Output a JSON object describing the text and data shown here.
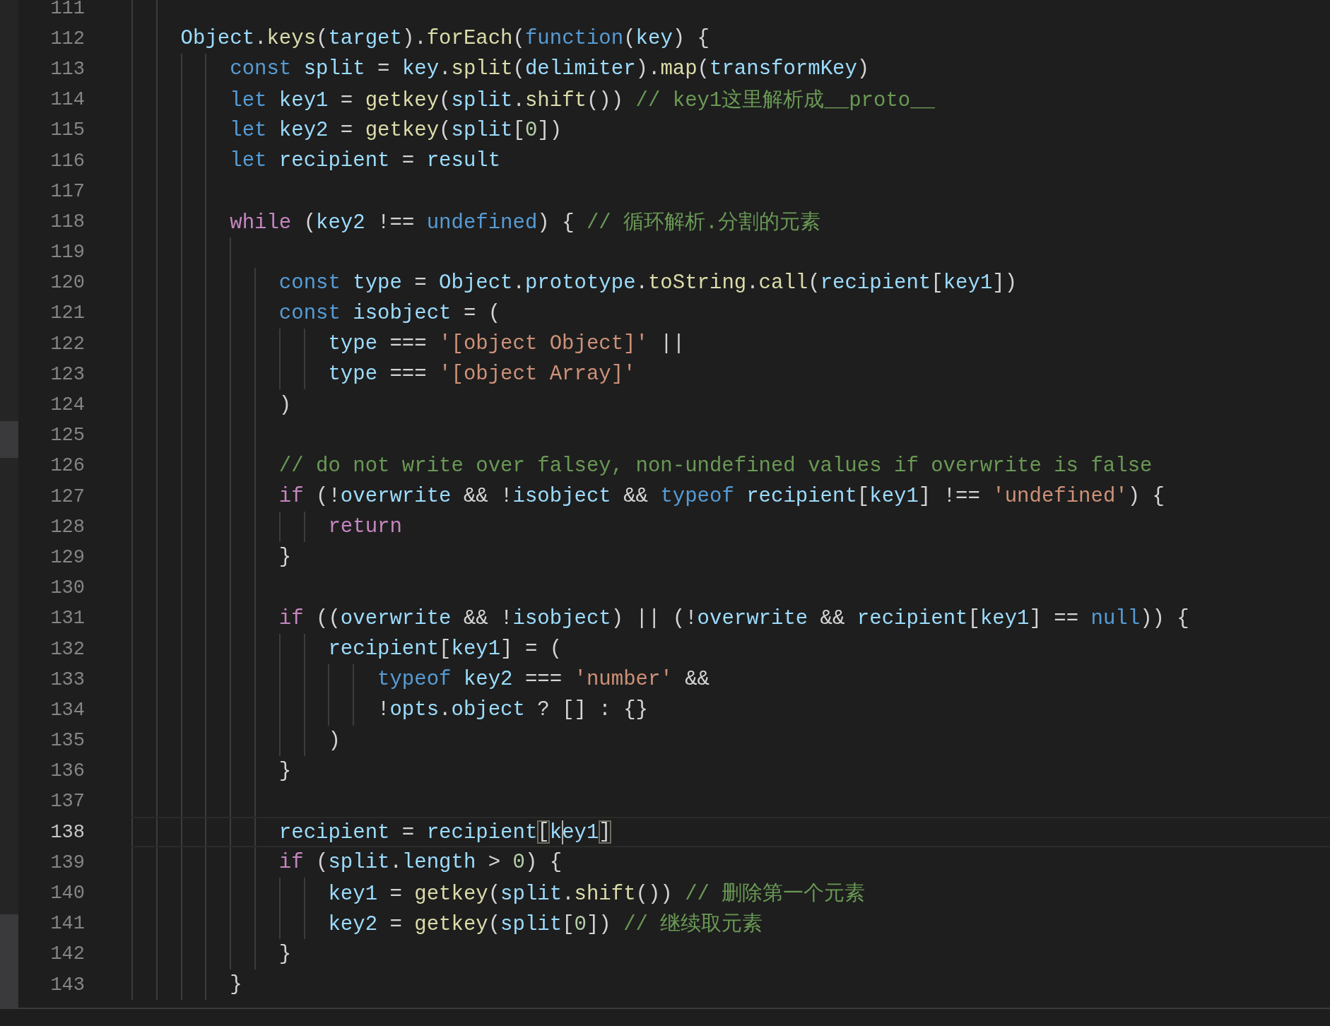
{
  "editor": {
    "lines": [
      {
        "number": "111",
        "current": false
      },
      {
        "number": "112",
        "current": false,
        "tokens": [
          {
            "kind": "variable",
            "text": "    Object"
          },
          {
            "kind": "plain",
            "text": "."
          },
          {
            "kind": "function",
            "text": "keys"
          },
          {
            "kind": "plain",
            "text": "("
          },
          {
            "kind": "variable",
            "text": "target"
          },
          {
            "kind": "plain",
            "text": ")."
          },
          {
            "kind": "function",
            "text": "forEach"
          },
          {
            "kind": "plain",
            "text": "("
          },
          {
            "kind": "keyword",
            "text": "function"
          },
          {
            "kind": "plain",
            "text": "("
          },
          {
            "kind": "variable",
            "text": "key"
          },
          {
            "kind": "plain",
            "text": ") {"
          }
        ]
      },
      {
        "number": "113",
        "current": false,
        "tokens": [
          {
            "kind": "keyword",
            "text": "        const"
          },
          {
            "kind": "variable",
            "text": " split"
          },
          {
            "kind": "plain",
            "text": " = "
          },
          {
            "kind": "variable",
            "text": "key"
          },
          {
            "kind": "plain",
            "text": "."
          },
          {
            "kind": "function",
            "text": "split"
          },
          {
            "kind": "plain",
            "text": "("
          },
          {
            "kind": "variable",
            "text": "delimiter"
          },
          {
            "kind": "plain",
            "text": ")."
          },
          {
            "kind": "function",
            "text": "map"
          },
          {
            "kind": "plain",
            "text": "("
          },
          {
            "kind": "variable",
            "text": "transformKey"
          },
          {
            "kind": "plain",
            "text": ")"
          }
        ]
      },
      {
        "number": "114",
        "current": false,
        "tokens": [
          {
            "kind": "keyword",
            "text": "        let"
          },
          {
            "kind": "variable",
            "text": " key1"
          },
          {
            "kind": "plain",
            "text": " = "
          },
          {
            "kind": "function",
            "text": "getkey"
          },
          {
            "kind": "plain",
            "text": "("
          },
          {
            "kind": "variable",
            "text": "split"
          },
          {
            "kind": "plain",
            "text": "."
          },
          {
            "kind": "function",
            "text": "shift"
          },
          {
            "kind": "plain",
            "text": "()) "
          },
          {
            "kind": "comment",
            "text": "// key1这里解析成__proto__"
          }
        ]
      },
      {
        "number": "115",
        "current": false,
        "tokens": [
          {
            "kind": "keyword",
            "text": "        let"
          },
          {
            "kind": "variable",
            "text": " key2"
          },
          {
            "kind": "plain",
            "text": " = "
          },
          {
            "kind": "function",
            "text": "getkey"
          },
          {
            "kind": "plain",
            "text": "("
          },
          {
            "kind": "variable",
            "text": "split"
          },
          {
            "kind": "plain",
            "text": "["
          },
          {
            "kind": "number",
            "text": "0"
          },
          {
            "kind": "plain",
            "text": "])"
          }
        ]
      },
      {
        "number": "116",
        "current": false,
        "tokens": [
          {
            "kind": "keyword",
            "text": "        let"
          },
          {
            "kind": "variable",
            "text": " recipient"
          },
          {
            "kind": "plain",
            "text": " = "
          },
          {
            "kind": "variable",
            "text": "result"
          }
        ]
      },
      {
        "number": "117",
        "current": false
      },
      {
        "number": "118",
        "current": false,
        "tokens": [
          {
            "kind": "control",
            "text": "        while"
          },
          {
            "kind": "plain",
            "text": " ("
          },
          {
            "kind": "variable",
            "text": "key2"
          },
          {
            "kind": "plain",
            "text": " !== "
          },
          {
            "kind": "keyword",
            "text": "undefined"
          },
          {
            "kind": "plain",
            "text": ") { "
          },
          {
            "kind": "comment",
            "text": "// 循环解析.分割的元素"
          }
        ]
      },
      {
        "number": "119",
        "current": false
      },
      {
        "number": "120",
        "current": false,
        "tokens": [
          {
            "kind": "keyword",
            "text": "            const"
          },
          {
            "kind": "variable",
            "text": " type"
          },
          {
            "kind": "plain",
            "text": " = "
          },
          {
            "kind": "variable",
            "text": "Object"
          },
          {
            "kind": "plain",
            "text": "."
          },
          {
            "kind": "variable",
            "text": "prototype"
          },
          {
            "kind": "plain",
            "text": "."
          },
          {
            "kind": "function",
            "text": "toString"
          },
          {
            "kind": "plain",
            "text": "."
          },
          {
            "kind": "function",
            "text": "call"
          },
          {
            "kind": "plain",
            "text": "("
          },
          {
            "kind": "variable",
            "text": "recipient"
          },
          {
            "kind": "plain",
            "text": "["
          },
          {
            "kind": "variable",
            "text": "key1"
          },
          {
            "kind": "plain",
            "text": "])"
          }
        ]
      },
      {
        "number": "121",
        "current": false,
        "tokens": [
          {
            "kind": "keyword",
            "text": "            const"
          },
          {
            "kind": "variable",
            "text": " isobject"
          },
          {
            "kind": "plain",
            "text": " = ("
          }
        ]
      },
      {
        "number": "122",
        "current": false,
        "tokens": [
          {
            "kind": "variable",
            "text": "                type"
          },
          {
            "kind": "plain",
            "text": " === "
          },
          {
            "kind": "string",
            "text": "'[object Object]'"
          },
          {
            "kind": "plain",
            "text": " ||"
          }
        ]
      },
      {
        "number": "123",
        "current": false,
        "tokens": [
          {
            "kind": "variable",
            "text": "                type"
          },
          {
            "kind": "plain",
            "text": " === "
          },
          {
            "kind": "string",
            "text": "'[object Array]'"
          }
        ]
      },
      {
        "number": "124",
        "current": false,
        "tokens": [
          {
            "kind": "plain",
            "text": "            )"
          }
        ]
      },
      {
        "number": "125",
        "current": false
      },
      {
        "number": "126",
        "current": false,
        "tokens": [
          {
            "kind": "comment",
            "text": "            // do not write over falsey, non-undefined values if overwrite is false"
          }
        ]
      },
      {
        "number": "127",
        "current": false,
        "tokens": [
          {
            "kind": "control",
            "text": "            if"
          },
          {
            "kind": "plain",
            "text": " (!"
          },
          {
            "kind": "variable",
            "text": "overwrite"
          },
          {
            "kind": "plain",
            "text": " && !"
          },
          {
            "kind": "variable",
            "text": "isobject"
          },
          {
            "kind": "plain",
            "text": " && "
          },
          {
            "kind": "keyword",
            "text": "typeof"
          },
          {
            "kind": "variable",
            "text": " recipient"
          },
          {
            "kind": "plain",
            "text": "["
          },
          {
            "kind": "variable",
            "text": "key1"
          },
          {
            "kind": "plain",
            "text": "] !== "
          },
          {
            "kind": "string",
            "text": "'undefined'"
          },
          {
            "kind": "plain",
            "text": ") {"
          }
        ]
      },
      {
        "number": "128",
        "current": false,
        "tokens": [
          {
            "kind": "control",
            "text": "                return"
          }
        ]
      },
      {
        "number": "129",
        "current": false,
        "tokens": [
          {
            "kind": "plain",
            "text": "            }"
          }
        ]
      },
      {
        "number": "130",
        "current": false
      },
      {
        "number": "131",
        "current": false,
        "tokens": [
          {
            "kind": "control",
            "text": "            if"
          },
          {
            "kind": "plain",
            "text": " (("
          },
          {
            "kind": "variable",
            "text": "overwrite"
          },
          {
            "kind": "plain",
            "text": " && !"
          },
          {
            "kind": "variable",
            "text": "isobject"
          },
          {
            "kind": "plain",
            "text": ") || (!"
          },
          {
            "kind": "variable",
            "text": "overwrite"
          },
          {
            "kind": "plain",
            "text": " && "
          },
          {
            "kind": "variable",
            "text": "recipient"
          },
          {
            "kind": "plain",
            "text": "["
          },
          {
            "kind": "variable",
            "text": "key1"
          },
          {
            "kind": "plain",
            "text": "] == "
          },
          {
            "kind": "keyword",
            "text": "null"
          },
          {
            "kind": "plain",
            "text": ")) {"
          }
        ]
      },
      {
        "number": "132",
        "current": false,
        "tokens": [
          {
            "kind": "variable",
            "text": "                recipient"
          },
          {
            "kind": "plain",
            "text": "["
          },
          {
            "kind": "variable",
            "text": "key1"
          },
          {
            "kind": "plain",
            "text": "] = ("
          }
        ]
      },
      {
        "number": "133",
        "current": false,
        "tokens": [
          {
            "kind": "keyword",
            "text": "                    typeof"
          },
          {
            "kind": "variable",
            "text": " key2"
          },
          {
            "kind": "plain",
            "text": " === "
          },
          {
            "kind": "string",
            "text": "'number'"
          },
          {
            "kind": "plain",
            "text": " &&"
          }
        ]
      },
      {
        "number": "134",
        "current": false,
        "tokens": [
          {
            "kind": "plain",
            "text": "                    !"
          },
          {
            "kind": "variable",
            "text": "opts"
          },
          {
            "kind": "plain",
            "text": "."
          },
          {
            "kind": "variable",
            "text": "object"
          },
          {
            "kind": "plain",
            "text": " ? [] : {}"
          }
        ]
      },
      {
        "number": "135",
        "current": false,
        "tokens": [
          {
            "kind": "plain",
            "text": "                )"
          }
        ]
      },
      {
        "number": "136",
        "current": false,
        "tokens": [
          {
            "kind": "plain",
            "text": "            }"
          }
        ]
      },
      {
        "number": "137",
        "current": false
      },
      {
        "number": "138",
        "current": true,
        "tokens": [
          {
            "kind": "variable",
            "text": "            recipient"
          },
          {
            "kind": "plain",
            "text": " = "
          },
          {
            "kind": "variable",
            "text": "recipient"
          },
          {
            "kind": "matched_bracket",
            "text": "["
          },
          {
            "kind": "variable",
            "text": "k",
            "caret": true
          },
          {
            "kind": "variable",
            "text": "ey1"
          },
          {
            "kind": "matched_bracket",
            "text": "]"
          }
        ]
      },
      {
        "number": "139",
        "current": false,
        "tokens": [
          {
            "kind": "control",
            "text": "            if"
          },
          {
            "kind": "plain",
            "text": " ("
          },
          {
            "kind": "variable",
            "text": "split"
          },
          {
            "kind": "plain",
            "text": "."
          },
          {
            "kind": "variable",
            "text": "length"
          },
          {
            "kind": "plain",
            "text": " > "
          },
          {
            "kind": "number",
            "text": "0"
          },
          {
            "kind": "plain",
            "text": ") {"
          }
        ]
      },
      {
        "number": "140",
        "current": false,
        "tokens": [
          {
            "kind": "variable",
            "text": "                key1"
          },
          {
            "kind": "plain",
            "text": " = "
          },
          {
            "kind": "function",
            "text": "getkey"
          },
          {
            "kind": "plain",
            "text": "("
          },
          {
            "kind": "variable",
            "text": "split"
          },
          {
            "kind": "plain",
            "text": "."
          },
          {
            "kind": "function",
            "text": "shift"
          },
          {
            "kind": "plain",
            "text": "()) "
          },
          {
            "kind": "comment",
            "text": "// 删除第一个元素"
          }
        ]
      },
      {
        "number": "141",
        "current": false,
        "tokens": [
          {
            "kind": "variable",
            "text": "                key2"
          },
          {
            "kind": "plain",
            "text": " = "
          },
          {
            "kind": "function",
            "text": "getkey"
          },
          {
            "kind": "plain",
            "text": "("
          },
          {
            "kind": "variable",
            "text": "split"
          },
          {
            "kind": "plain",
            "text": "["
          },
          {
            "kind": "number",
            "text": "0"
          },
          {
            "kind": "plain",
            "text": "]) "
          },
          {
            "kind": "comment",
            "text": "// 继续取元素"
          }
        ]
      },
      {
        "number": "142",
        "current": false,
        "tokens": [
          {
            "kind": "plain",
            "text": "            }"
          }
        ]
      },
      {
        "number": "143",
        "current": false,
        "tokens": [
          {
            "kind": "plain",
            "text": "        }"
          }
        ]
      }
    ]
  }
}
